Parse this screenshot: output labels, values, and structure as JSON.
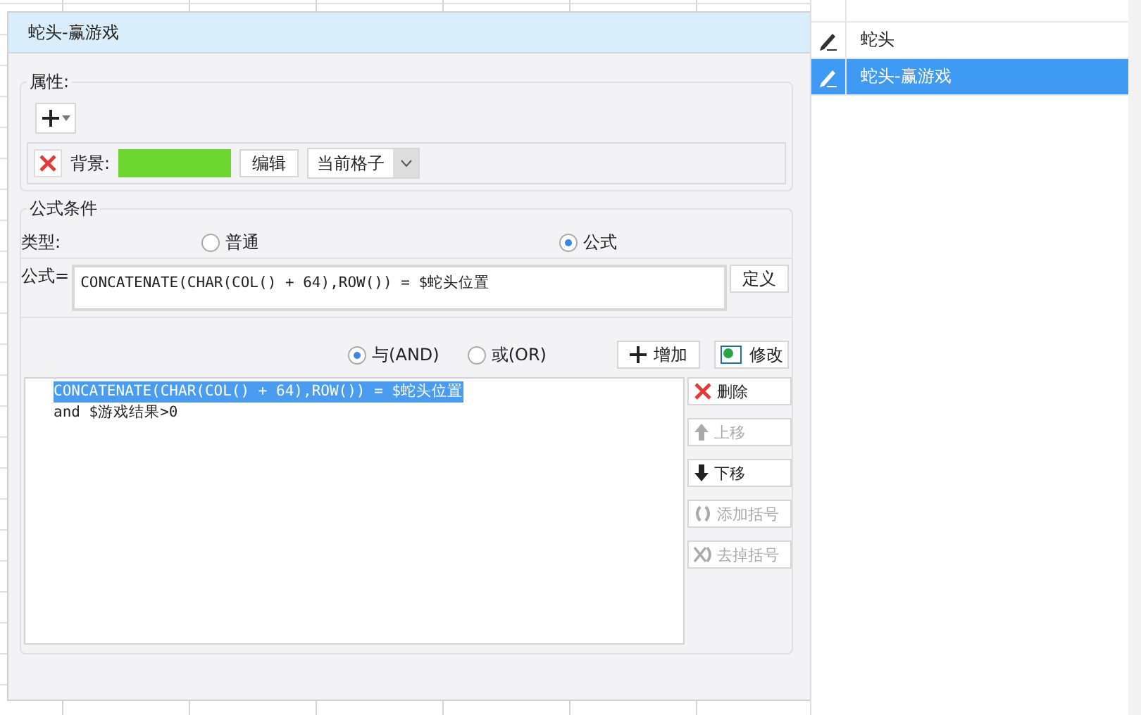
{
  "dialog": {
    "title": "蛇头-赢游戏",
    "properties": {
      "label": "属性:",
      "background": {
        "label": "背景:",
        "color": "#6dd630"
      },
      "edit_button": "编辑",
      "scope": "当前格子"
    },
    "formula_conditions": {
      "title": "公式条件",
      "type_label": "类型:",
      "type_options": [
        {
          "label": "普通",
          "selected": false
        },
        {
          "label": "公式",
          "selected": true
        }
      ],
      "formula_label": "公式=",
      "formula": "CONCATENATE(CHAR(COL() + 64),ROW()) = $蛇头位置",
      "define_button": "定义",
      "logic_options": [
        {
          "label": "与(AND)",
          "selected": true
        },
        {
          "label": "或(OR)",
          "selected": false
        }
      ],
      "add_button": "增加",
      "modify_button": "修改",
      "conditions": [
        {
          "text": "CONCATENATE(CHAR(COL() + 64),ROW()) = $蛇头位置",
          "selected": true
        },
        {
          "text": "and $游戏结果>0",
          "selected": false
        }
      ],
      "actions": [
        {
          "label": "删除",
          "kind": "delete",
          "disabled": false
        },
        {
          "label": "上移",
          "kind": "up",
          "disabled": true
        },
        {
          "label": "下移",
          "kind": "down",
          "disabled": false
        },
        {
          "label": "添加括号",
          "kind": "add-parens",
          "disabled": true
        },
        {
          "label": "去掉括号",
          "kind": "remove-parens",
          "disabled": true
        }
      ]
    }
  },
  "side_list": {
    "items": [
      {
        "label": "蛇头",
        "selected": false
      },
      {
        "label": "蛇头-赢游戏",
        "selected": true
      }
    ]
  }
}
